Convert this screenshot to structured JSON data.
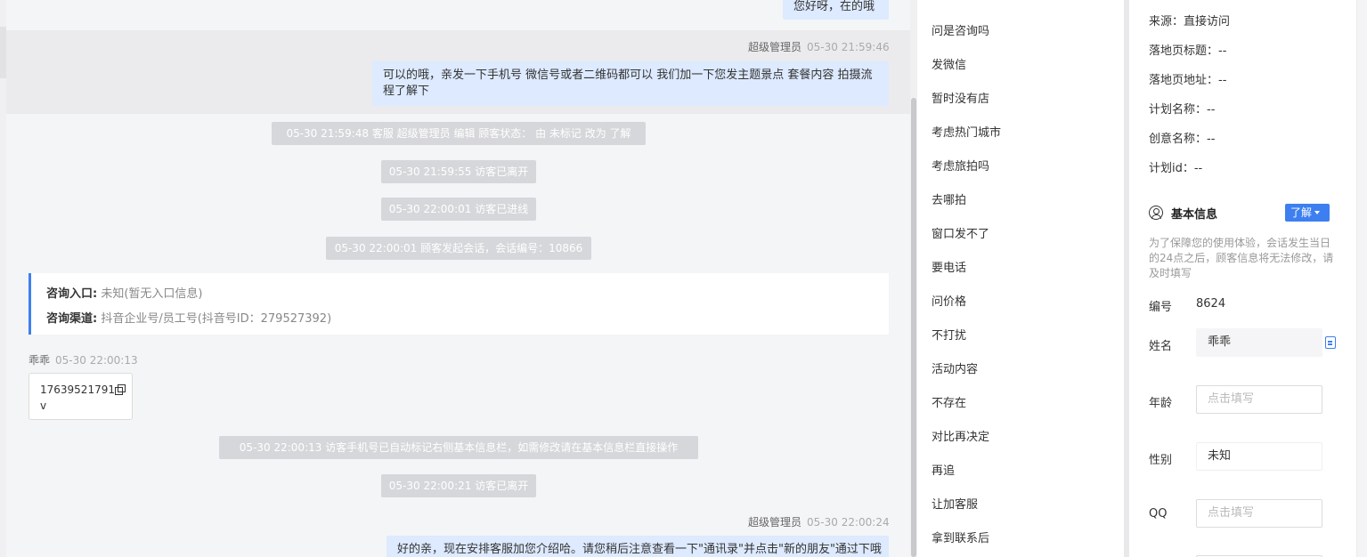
{
  "chat": {
    "top_bubble": "您好呀，在的哦",
    "msg1": {
      "sender": "超级管理员",
      "time": "05-30 21:59:46",
      "text": "可以的哦，亲发一下手机号 微信号或者二维码都可以 我们加一下您发主题景点 套餐内容 拍摄流程了解下"
    },
    "sys1": "05-30 21:59:48 客服 超级管理员 编辑 顾客状态： 由 未标记 改为 了解",
    "sys2": "05-30 21:59:55 访客已离开",
    "sys3": "05-30 22:00:01 访客已进线",
    "sys4": "05-30 22:00:01 顾客发起会话，会话编号：10866",
    "info_card": {
      "entry_label": "咨询入口:",
      "entry_value": "未知(暂无入口信息)",
      "channel_label": "咨询渠道:",
      "channel_value": "抖音企业号/员工号(抖音号ID：279527392)"
    },
    "visitor_msg": {
      "sender": "乖乖",
      "time": "05-30 22:00:13",
      "line1": "17639521791",
      "line2": "v"
    },
    "sys5": "05-30 22:00:13 访客手机号已自动标记右侧基本信息栏，如需修改请在基本信息栏直接操作",
    "sys6": "05-30 22:00:21 访客已离开",
    "msg2": {
      "sender": "超级管理员",
      "time": "05-30 22:00:24",
      "text": "好的亲，现在安排客服加您介绍哈。请您稍后注意查看一下\"通讯录\"并点击\"新的朋友\"通过下哦"
    }
  },
  "quick_replies": [
    "问是咨询吗",
    "发微信",
    "暂时没有店",
    "考虑热门城市",
    "考虑旅拍吗",
    "去哪拍",
    "窗口发不了",
    "要电话",
    "问价格",
    "不打扰",
    "活动内容",
    "不存在",
    "对比再决定",
    "再追",
    "让加客服",
    "拿到联系后"
  ],
  "panel": {
    "source": "来源：直接访问",
    "landing_title": "落地页标题：--",
    "landing_url": "落地页地址：--",
    "plan_name": "计划名称：--",
    "creative_name": "创意名称：--",
    "plan_id": "计划id：--",
    "basic_title": "基本信息",
    "status_tag": "了解",
    "note": "为了保障您的使用体验，会话发生当日的24点之后，顾客信息将无法修改，请及时填写",
    "id_label": "编号",
    "id_value": "8624",
    "name_label": "姓名",
    "name_value": "乖乖",
    "age_label": "年龄",
    "age_placeholder": "点击填写",
    "gender_label": "性别",
    "gender_value": "未知",
    "qq_label": "QQ",
    "qq_placeholder": "点击填写"
  }
}
